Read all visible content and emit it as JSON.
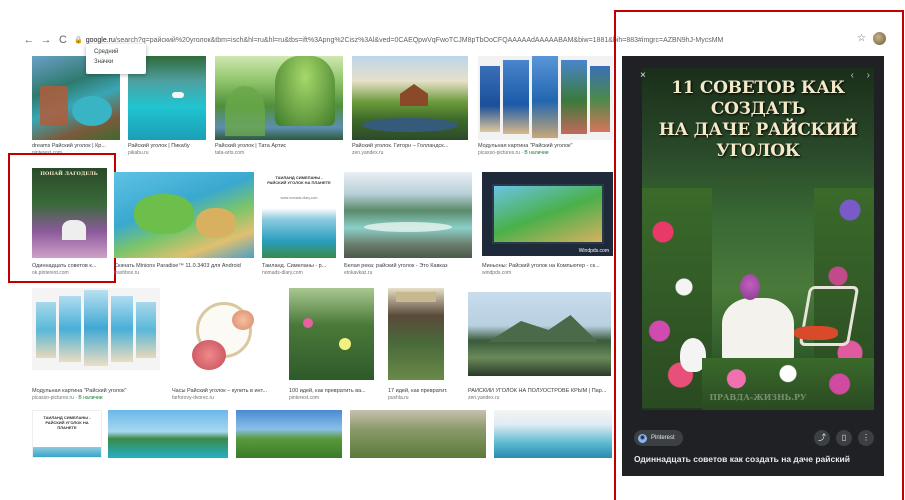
{
  "browser": {
    "back": "←",
    "forward": "→",
    "reload": "C",
    "url_host": "google.ru",
    "url_path": "/search?q=райский%20уголок&tbm=isch&hl=ru&hl=ru&tbs=ift%3Apng%2Cisz%3Al&ved=0CAEQpwVqFwoTCJM8pTbOoCFQAAAAAdAAAAABAM&biw=1881&bih=883#imgrc=AZBN9hJ-MycsMM",
    "star": "☆"
  },
  "dropdown": {
    "items": [
      "Средний",
      "Значки"
    ]
  },
  "results": [
    {
      "caption": "dreams Райский уголок | Кр...",
      "source": "pinterest.com"
    },
    {
      "caption": "Райский уголок | Пикабу",
      "source": "pikabu.ru"
    },
    {
      "caption": "Райский уголок | Тата Артис",
      "source": "tata-arts.com"
    },
    {
      "caption": "Райский уголок. Гиторн – Голландск...",
      "source": "zen.yandex.ru"
    },
    {
      "caption": "Модульная картина \"Райский уголок\"",
      "source": "picasso-pictures.ru",
      "badge": "В наличии"
    },
    {
      "caption": "Одиннадцать советов к...",
      "source": "ok.pinterest.com"
    },
    {
      "caption": "Скачать Minions Paradise™ 11.0.3403 для Android",
      "source": "trashbox.ru"
    },
    {
      "caption": "Таиланд. Симеланы - р...",
      "source": "nomads-diary.com"
    },
    {
      "caption": "Белая река: райский уголок - Это Кавказ",
      "source": "etokavkaz.ru"
    },
    {
      "caption": "Миньоны: Райский уголок на Компьютер - ск...",
      "source": "windpds.com"
    },
    {
      "caption": "Модульная картина \"Райский уголок\"",
      "source": "picasso-pictures.ru",
      "badge": "В наличии"
    },
    {
      "caption": "Часы Райский уголок – купить в инт...",
      "source": "farforovy-dvorec.ru"
    },
    {
      "caption": "100 идей, как превратить ва...",
      "source": "pinterest.com"
    },
    {
      "caption": "17 идей, как превратит...",
      "source": "pushla.ru"
    },
    {
      "caption": "РАЙСКИЙ УГОЛОК НА ПОЛУОСТРОВЕ КРЫМ | Пар...",
      "source": "zen.yandex.ru"
    }
  ],
  "thumb_text": {
    "pinterest_thumb": "ПОПАЙ ЛАГОДЕЛЬ",
    "card_top": "ТАИЛАНД СИМЕЛАНЫ - РАЙСКИЙ УГОЛОК НА ПЛАНЕТЕ",
    "card_sub": "www.nomads-diary.com",
    "windpds": "Windpds.com"
  },
  "preview": {
    "title_line1": "11 СОВЕТОВ КАК СОЗДАТЬ",
    "title_line2": "НА ДАЧЕ РАЙСКИЙ УГОЛОК",
    "watermark": "ПРАВДА-ЖИЗНЬ.РУ",
    "source_chip": "Pinterest",
    "caption": "Одиннадцать советов как создать на даче райский",
    "close": "×",
    "prev": "‹",
    "next": "›"
  }
}
